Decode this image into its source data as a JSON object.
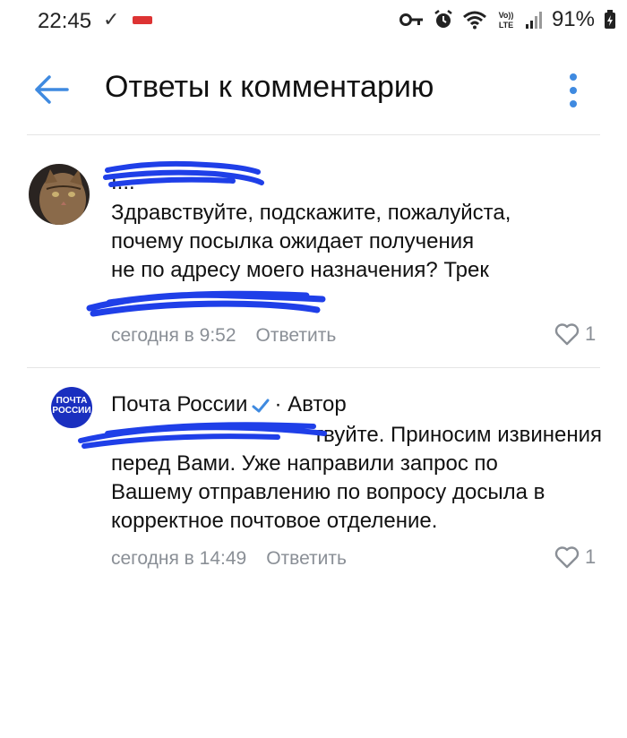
{
  "status_bar": {
    "time": "22:45",
    "check_glyph": "✓",
    "battery_text": "91%",
    "icons": [
      "key-icon",
      "alarm-icon",
      "wifi-icon",
      "volte-icon",
      "signal-icon",
      "battery-icon"
    ]
  },
  "header": {
    "title": "Ответы к комментарию"
  },
  "comments": [
    {
      "author": "I...",
      "lines": [
        "Здравствуйте,  подскажите,  пожалуйста,",
        "почему посылка ожидает получения",
        "не по адресу моего назначения? Трек"
      ],
      "time": "сегодня в 9:52",
      "reply_label": "Ответить",
      "likes": "1"
    },
    {
      "author": "Почта России",
      "author_badge": "· Автор",
      "avatar_text": [
        "ПОЧТА",
        "РОССИИ"
      ],
      "lines": [
        "твуйте. Приносим извинения",
        "перед Вами. Уже направили запрос по",
        "Вашему отправлению по вопросу досыла в",
        "корректное почтовое отделение."
      ],
      "time": "сегодня в 14:49",
      "reply_label": "Ответить",
      "likes": "1"
    }
  ],
  "colors": {
    "accent": "#3f8ae0",
    "scribble": "#1f3fe8",
    "secondary_text": "#8a8f96",
    "pochta_blue": "#1a2fbf"
  }
}
